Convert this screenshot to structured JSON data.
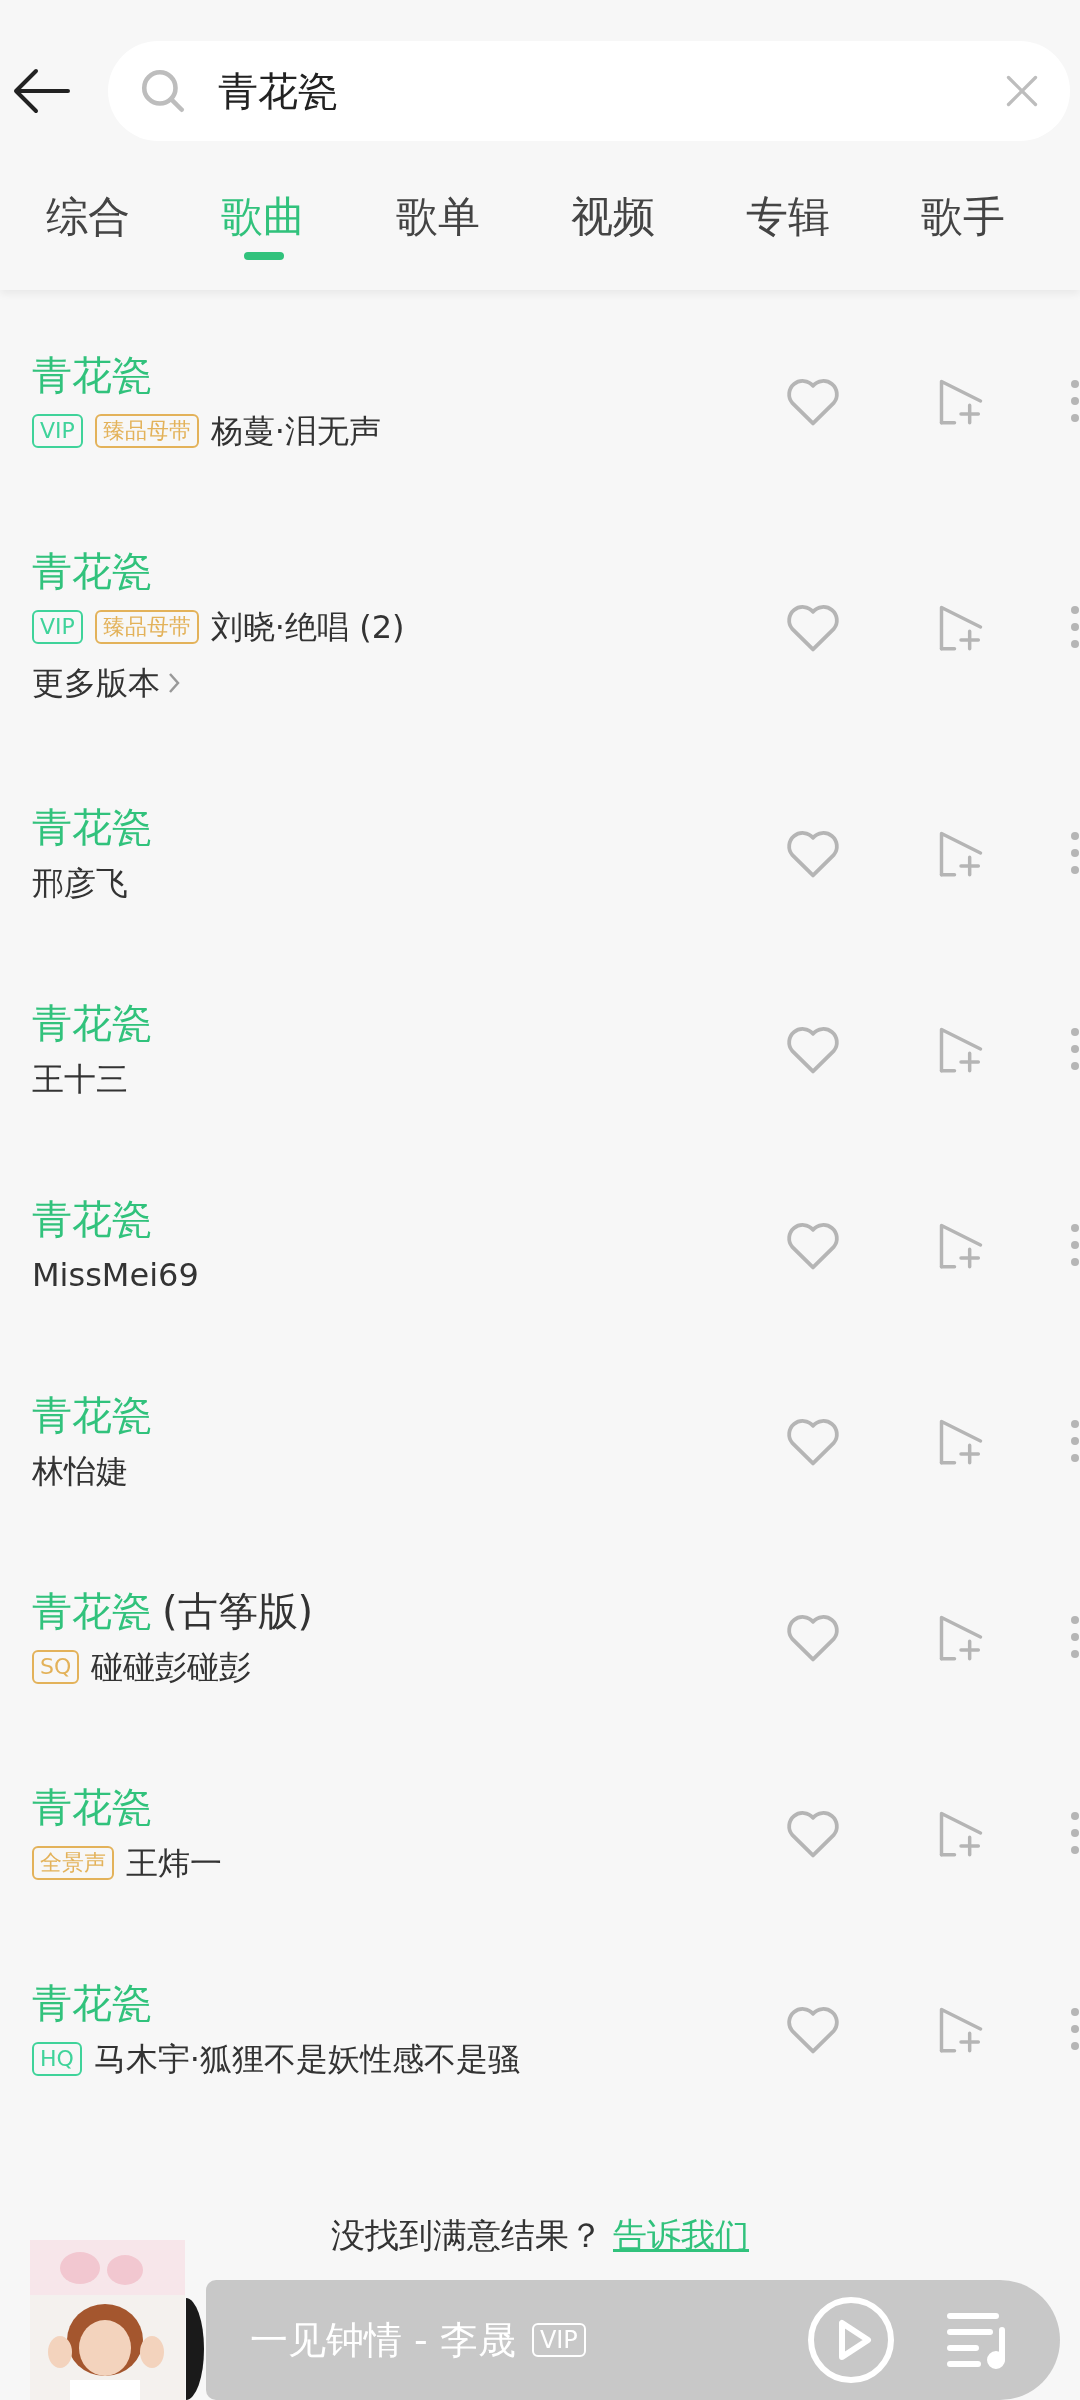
{
  "search": {
    "value": "青花瓷"
  },
  "tabs": [
    {
      "label": "综合",
      "selected": false
    },
    {
      "label": "歌曲",
      "selected": true
    },
    {
      "label": "歌单",
      "selected": false
    },
    {
      "label": "视频",
      "selected": false
    },
    {
      "label": "专辑",
      "selected": false
    },
    {
      "label": "歌手",
      "selected": false
    }
  ],
  "songs": [
    {
      "title": "青花瓷",
      "badges": [
        {
          "label": "VIP",
          "color": "#3fd39a"
        },
        {
          "label": "臻品母带",
          "color": "#e3b25a"
        }
      ],
      "artist": "杨蔓·泪无声"
    },
    {
      "title": "青花瓷",
      "badges": [
        {
          "label": "VIP",
          "color": "#3fd39a"
        },
        {
          "label": "臻品母带",
          "color": "#e3b25a"
        }
      ],
      "artist": "刘晓·绝唱 (2)",
      "more_versions": "更多版本"
    },
    {
      "title": "青花瓷",
      "artist": "邢彦飞"
    },
    {
      "title": "青花瓷",
      "artist": "王十三"
    },
    {
      "title": "青花瓷",
      "artist": "MissMei69"
    },
    {
      "title": "青花瓷",
      "artist": "林怡婕"
    },
    {
      "title": "青花瓷",
      "suffix": "(古筝版)",
      "badges": [
        {
          "label": "SQ",
          "color": "#e3b25a"
        }
      ],
      "artist": "碰碰彭碰彭"
    },
    {
      "title": "青花瓷",
      "badges": [
        {
          "label": "全景声",
          "color": "#e3b25a"
        }
      ],
      "artist": "王炜一"
    },
    {
      "title": "青花瓷",
      "badges": [
        {
          "label": "HQ",
          "color": "#3fd39a"
        }
      ],
      "artist": "马木宇·狐狸不是妖性感不是骚"
    }
  ],
  "feedback": {
    "text": "没找到满意结果？",
    "link": "告诉我们"
  },
  "player": {
    "track": "一见钟情 - 李晟",
    "badge": "VIP"
  }
}
